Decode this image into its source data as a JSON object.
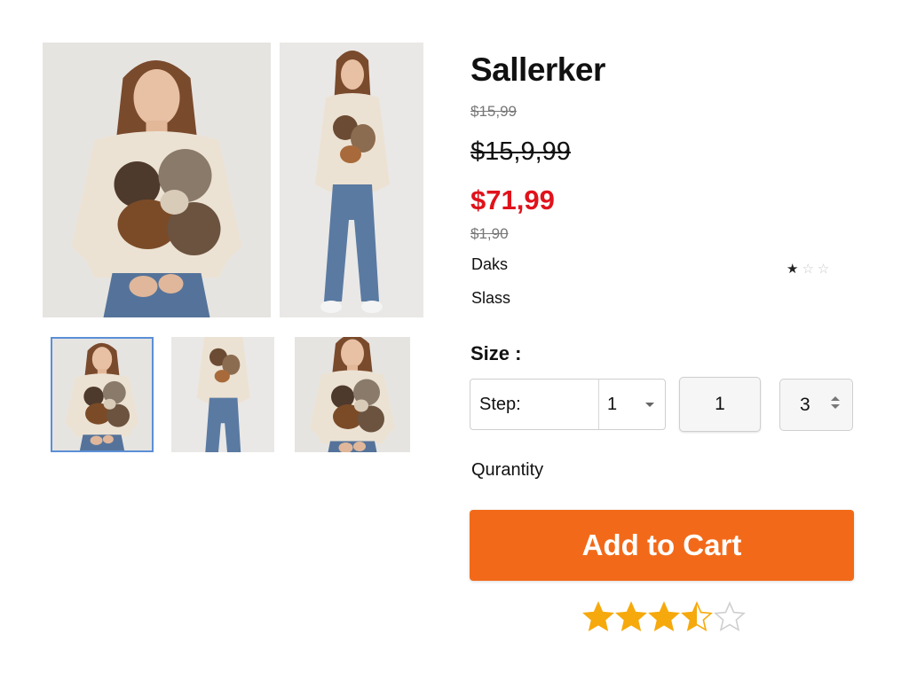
{
  "product": {
    "title": "Sallerker",
    "price_old_small": "$15,99",
    "price_old_large": "$15,9,99",
    "price_sale": "$71,99",
    "price_note": "$1,90",
    "attribute_1": "Daks",
    "attribute_2": "Slass"
  },
  "mini_rating": {
    "filled": 1,
    "total": 3
  },
  "options": {
    "size_label": "Size :",
    "step_label": "Step:",
    "step_value": "1",
    "quantity_value": "1",
    "stepper_value": "3",
    "quantity_label": "Qurantity"
  },
  "cart": {
    "button_label": "Add to Cart"
  },
  "rating": {
    "value": 3.5,
    "max": 5
  },
  "colors": {
    "accent": "#f26a19",
    "sale_price": "#e0121b",
    "star": "#f6a90c",
    "thumb_selected_border": "#5b8fd6"
  },
  "icons": {
    "mini_star": "star-icon",
    "rating_star": "star-icon",
    "select_caret": "chevron-down-icon",
    "stepper_arrows": "up-down-arrows-icon"
  }
}
